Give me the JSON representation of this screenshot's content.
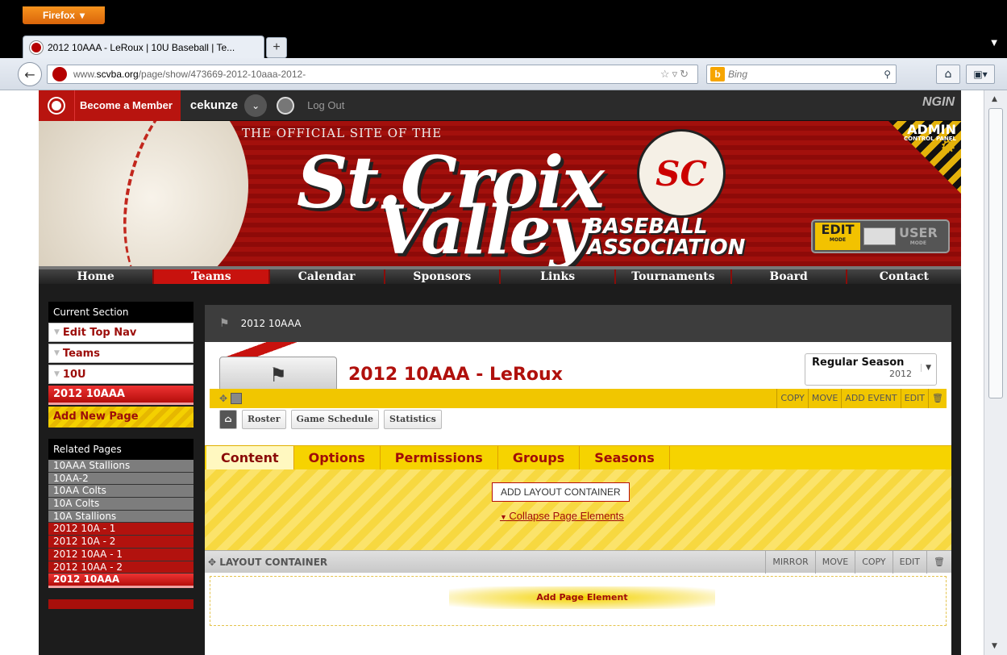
{
  "browser": {
    "menu_label": "Firefox",
    "tab_title": "2012 10AAA - LeRoux | 10U Baseball | Te...",
    "new_tab": "+",
    "url_prefix": "www.",
    "url_domain": "scvba.org",
    "url_path": "/page/show/473669-2012-10aaa-2012-",
    "search_engine": "Bing",
    "search_placeholder": "Bing"
  },
  "memberbar": {
    "become_member": "Become a Member",
    "username": "cekunze",
    "logout": "Log Out",
    "ngin": "NGIN"
  },
  "banner": {
    "tagline": "THE OFFICIAL SITE OF THE",
    "line1": "St.Croix",
    "line2": "Valley",
    "logo_text": "SC",
    "association_line1": "BASEBALL",
    "association_line2": "ASSOCIATION",
    "admin": "ADMIN",
    "admin_sub": "CONTROL PANEL",
    "edit_mode": "EDIT",
    "edit_mode_sub": "MODE",
    "user_mode": "USER",
    "user_mode_sub": "MODE"
  },
  "nav": [
    "Home",
    "Teams",
    "Calendar",
    "Sponsors",
    "Links",
    "Tournaments",
    "Board",
    "Contact"
  ],
  "sidebar": {
    "current_section_label": "Current Section",
    "crumbs": [
      "Edit Top Nav",
      "Teams",
      "10U"
    ],
    "current": "2012 10AAA",
    "add_page": "Add New Page",
    "related_label": "Related Pages",
    "related": [
      {
        "label": "10AAA Stallions",
        "style": "grey"
      },
      {
        "label": "10AA-2",
        "style": "grey"
      },
      {
        "label": "10AA Colts",
        "style": "grey"
      },
      {
        "label": "10A Colts",
        "style": "grey"
      },
      {
        "label": "10A Stallions",
        "style": "grey"
      },
      {
        "label": "2012 10A - 1",
        "style": "red"
      },
      {
        "label": "2012 10A - 2",
        "style": "red"
      },
      {
        "label": "2012 10AA - 1",
        "style": "red"
      },
      {
        "label": "2012 10AA - 2",
        "style": "red"
      },
      {
        "label": "2012 10AAA",
        "style": "sel"
      }
    ]
  },
  "content": {
    "breadcrumb": "2012 10AAA",
    "title": "2012 10AAA - LeRoux",
    "season_name": "Regular Season",
    "season_year": "2012",
    "subnav": [
      "Roster",
      "Game Schedule",
      "Statistics"
    ],
    "tabs": [
      "Content",
      "Options",
      "Permissions",
      "Groups",
      "Seasons"
    ],
    "active_tab": "Content",
    "add_layout_container": "ADD LAYOUT CONTAINER",
    "collapse": "Collapse Page Elements",
    "layout_container_title": "LAYOUT CONTAINER",
    "layout_buttons": [
      "MIRROR",
      "MOVE",
      "COPY",
      "EDIT"
    ],
    "add_page_element": "Add Page Element",
    "element_buttons": [
      "COPY",
      "MOVE",
      "ADD EVENT",
      "EDIT"
    ]
  },
  "colors": {
    "brand_red": "#b8140f",
    "accent_yellow": "#f6d300",
    "dark": "#1c1c1c"
  }
}
